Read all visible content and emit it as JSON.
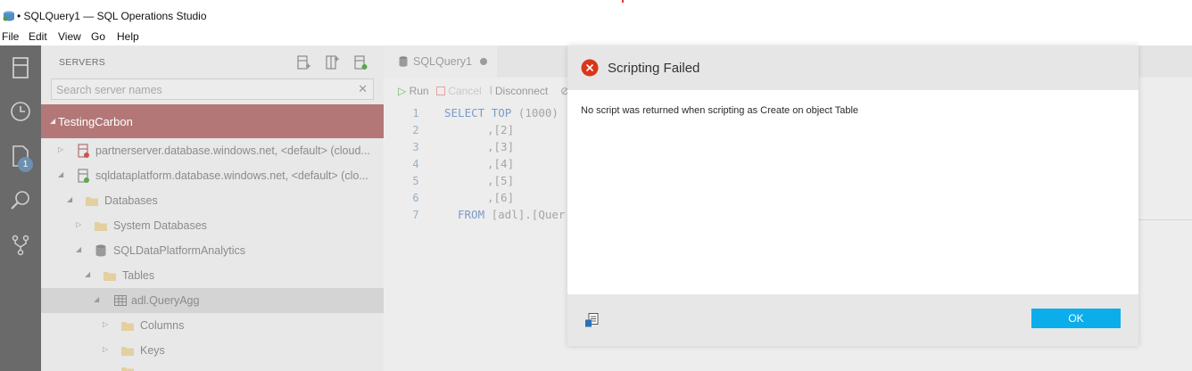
{
  "window": {
    "title": "• SQLQuery1 — SQL Operations Studio"
  },
  "menu": {
    "file": "File",
    "edit": "Edit",
    "view": "View",
    "go": "Go",
    "help": "Help"
  },
  "activity": {
    "badge": "1"
  },
  "sidebar": {
    "header": "SERVERS",
    "search_placeholder": "Search server names",
    "search_clear": "✕",
    "group": "TestingCarbon",
    "tree": [
      {
        "label": "partnerserver.database.windows.net, <default> (cloud..."
      },
      {
        "label": "sqldataplatform.database.windows.net, <default> (clo..."
      },
      {
        "label": "Databases"
      },
      {
        "label": "System Databases"
      },
      {
        "label": "SQLDataPlatformAnalytics"
      },
      {
        "label": "Tables"
      },
      {
        "label": "adl.QueryAgg"
      },
      {
        "label": "Columns"
      },
      {
        "label": "Keys"
      }
    ]
  },
  "editor": {
    "tab_label": "SQLQuery1",
    "toolbar": {
      "run": "Run",
      "cancel": "Cancel",
      "disconnect": "Disconnect"
    },
    "line_numbers": [
      "1",
      "2",
      "3",
      "4",
      "5",
      "6",
      "7"
    ],
    "lines": {
      "l1_kw1": "SELECT",
      "l1_kw2": "TOP",
      "l1_rest": " (1000)",
      "l2": ",[2]",
      "l3": ",[3]",
      "l4": ",[4]",
      "l5": ",[5]",
      "l6": ",[6]",
      "l7_kw": "FROM",
      "l7_rest": " [adl].[Quer"
    }
  },
  "dialog": {
    "title": "Scripting Failed",
    "message": "No script was returned when scripting as Create on object Table",
    "ok": "OK"
  },
  "colors": {
    "sidebar_group": "#b37777",
    "ok_button": "#0cadeb",
    "error_icon": "#d9361b"
  }
}
